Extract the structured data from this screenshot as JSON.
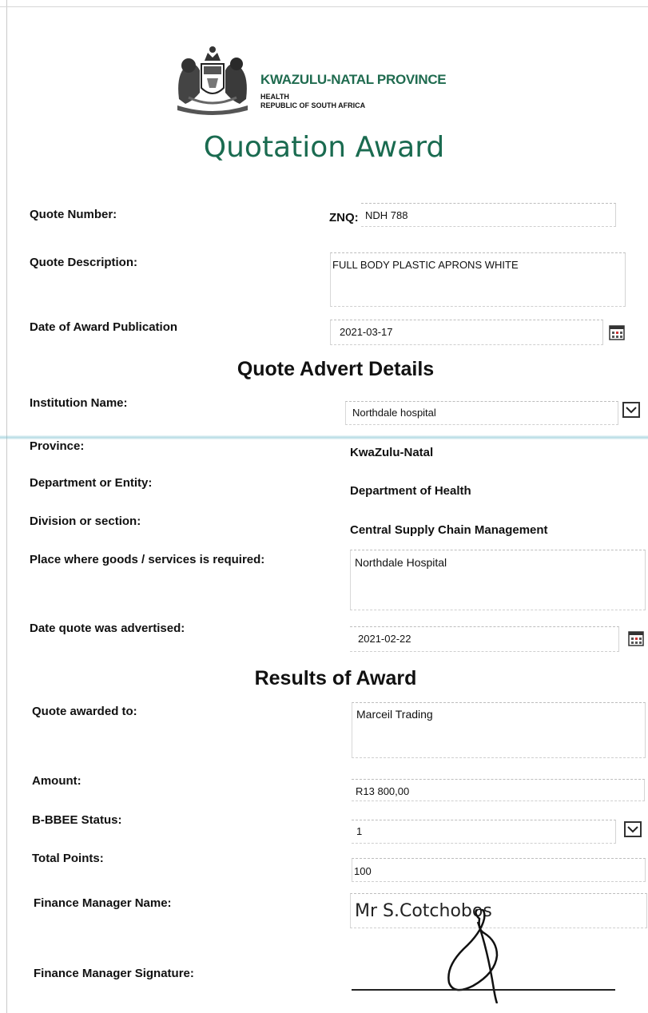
{
  "header": {
    "province_name": "KWAZULU-NATAL PROVINCE",
    "department": "HEALTH",
    "country": "REPUBLIC OF SOUTH AFRICA",
    "title": "Quotation Award",
    "crest_icon": "coat-of-arms-icon"
  },
  "quote": {
    "number_label": "Quote Number:",
    "number_prefix": "ZNQ:",
    "number_value": "NDH 788",
    "description_label": "Quote Description:",
    "description_value": "FULL BODY PLASTIC APRONS WHITE",
    "publication_label": "Date of Award Publication",
    "publication_value": "2021-03-17"
  },
  "advert": {
    "heading": "Quote Advert Details",
    "institution_label": "Institution Name:",
    "institution_value": "Northdale hospital",
    "province_label": "Province:",
    "province_value": "KwaZulu-Natal",
    "department_label": "Department or Entity:",
    "department_value": "Department of Health",
    "division_label": "Division or section:",
    "division_value": "Central Supply Chain Management",
    "place_label": "Place where goods /  services is required:",
    "place_value": "Northdale Hospital",
    "advertised_label": "Date quote was advertised:",
    "advertised_value": "2021-02-22"
  },
  "results": {
    "heading": "Results of Award",
    "awarded_label": "Quote awarded to:",
    "awarded_value": "Marceil Trading",
    "amount_label": "Amount:",
    "amount_value": "R13 800,00",
    "bbbee_label": "B-BBEE Status:",
    "bbbee_value": "1",
    "points_label": "Total Points:",
    "points_value": "100",
    "manager_label": "Finance Manager Name:",
    "manager_value": "Mr S.Cotchobos",
    "signature_label": "Finance Manager Signature:"
  },
  "colors": {
    "brand_green": "#1f6b4f",
    "title_green": "#1a6b50"
  }
}
